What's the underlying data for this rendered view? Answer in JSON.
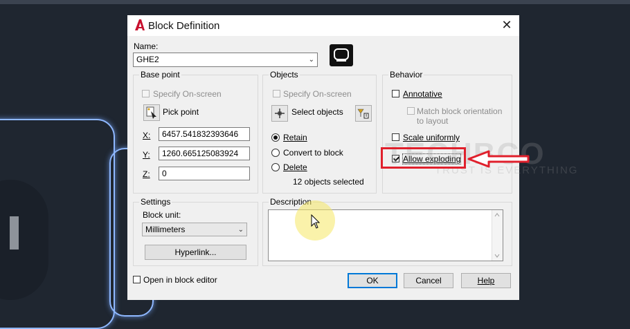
{
  "dialog": {
    "title": "Block Definition",
    "close_glyph": "✕",
    "title_icon": "autocad-logo-icon"
  },
  "name": {
    "label": "Name:",
    "value": "GHE2"
  },
  "base_point": {
    "title": "Base point",
    "specify_onscreen": "Specify On-screen",
    "pick_point": "Pick point",
    "x_label": "X:",
    "x_value": "6457.541832393646",
    "y_label": "Y:",
    "y_value": "1260.665125083924",
    "z_label": "Z:",
    "z_value": "0"
  },
  "objects": {
    "title": "Objects",
    "specify_onscreen": "Specify On-screen",
    "select_objects": "Select objects",
    "retain": "Retain",
    "convert": "Convert to block",
    "delete": "Delete",
    "status": "12 objects selected"
  },
  "behavior": {
    "title": "Behavior",
    "annotative": "Annotative",
    "match_orientation_line1": "Match block orientation",
    "match_orientation_line2": "to layout",
    "scale_uniformly": "Scale uniformly",
    "allow_exploding": "Allow exploding"
  },
  "settings": {
    "title": "Settings",
    "block_unit_label": "Block unit:",
    "block_unit_value": "Millimeters",
    "hyperlink": "Hyperlink..."
  },
  "description": {
    "title": "Description"
  },
  "footer": {
    "open_in_editor": "Open in block editor",
    "ok": "OK",
    "cancel": "Cancel",
    "help": "Help"
  },
  "watermark": {
    "main": "TECHBCO",
    "sub": "TRUST IS EVERYTHING"
  },
  "colors": {
    "annotation_red": "#e0202c",
    "cad_line": "#8fb8ff",
    "default_button_border": "#0078d7"
  }
}
